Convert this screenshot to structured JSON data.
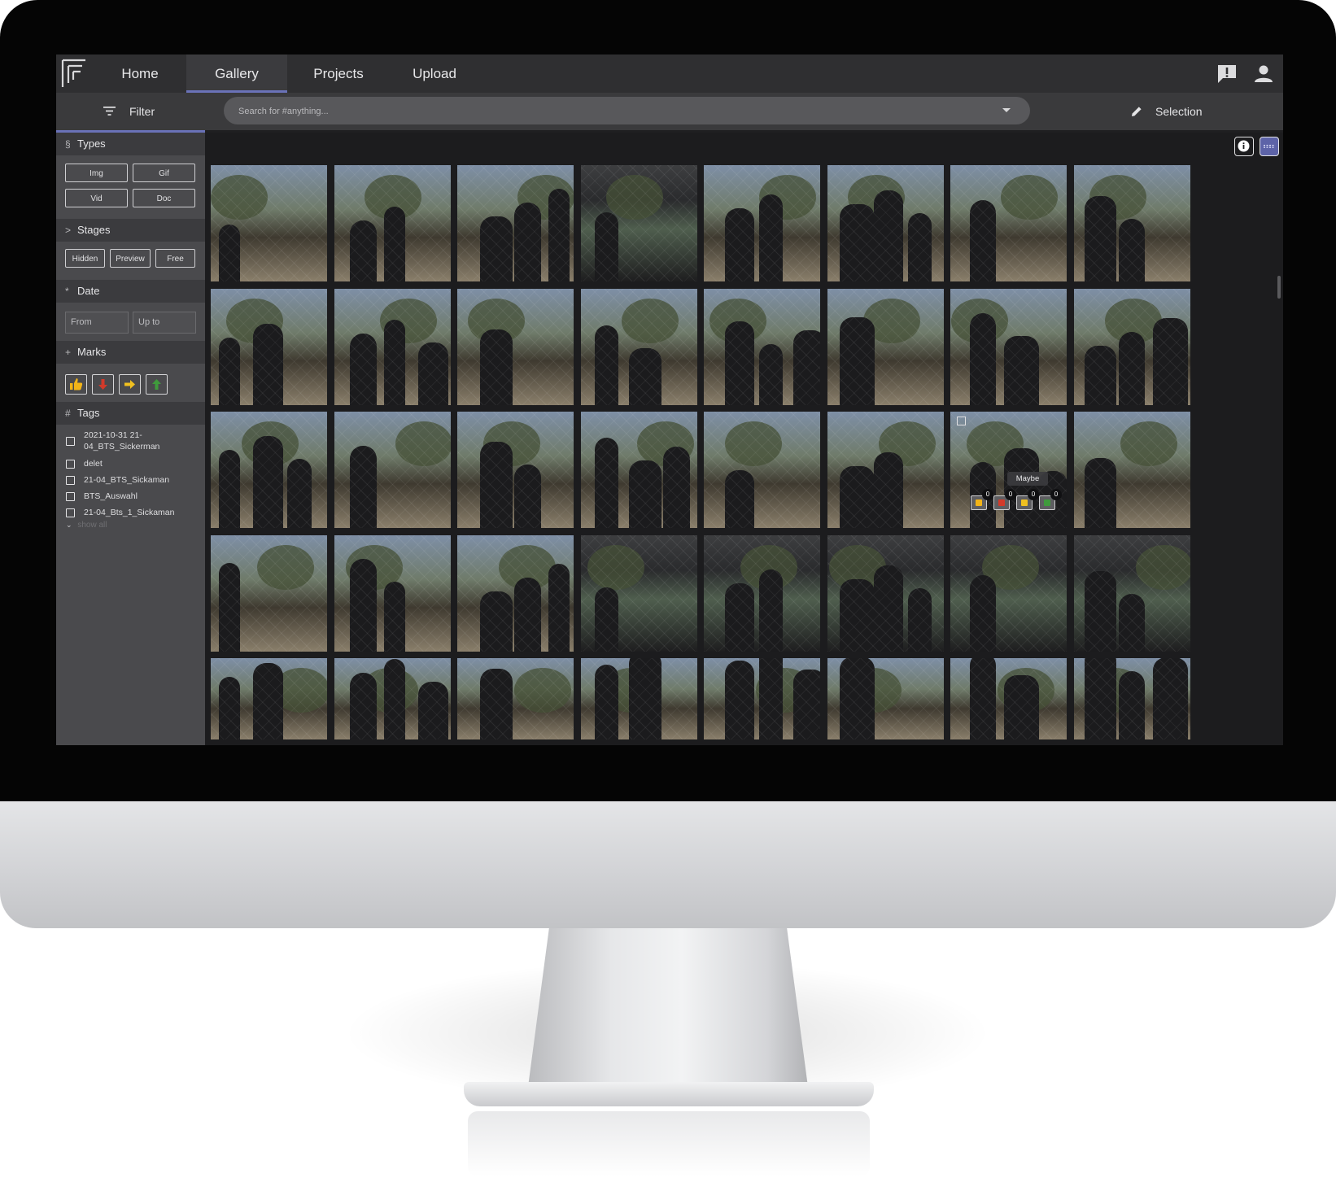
{
  "nav": {
    "items": [
      "Home",
      "Gallery",
      "Projects",
      "Upload"
    ],
    "active": "Gallery"
  },
  "toolbar": {
    "filter_label": "Filter",
    "search_placeholder": "Search for #anything...",
    "selection_label": "Selection"
  },
  "sidebar": {
    "types": {
      "symbol": "§",
      "title": "Types",
      "chips": [
        "Img",
        "Gif",
        "Vid",
        "Doc"
      ]
    },
    "stages": {
      "symbol": ">",
      "title": "Stages",
      "chips": [
        "Hidden",
        "Preview",
        "Free"
      ]
    },
    "date": {
      "symbol": "*",
      "title": "Date",
      "from_placeholder": "From",
      "upto_placeholder": "Up to"
    },
    "marks": {
      "symbol": "+",
      "title": "Marks",
      "icons": [
        "thumbs-up-icon",
        "arrow-down-icon",
        "arrow-right-icon",
        "arrow-up-icon"
      ]
    },
    "tags": {
      "symbol": "#",
      "title": "Tags",
      "items": [
        "2021-10-31 21-04_BTS_Sickerman",
        "delet",
        "21-04_BTS_Sickaman",
        "BTS_Auswahl",
        "21-04_Bts_1_Sickaman"
      ],
      "show_all": "show all"
    }
  },
  "gallery": {
    "rows": 5,
    "cols": 8,
    "hovered_tile": {
      "tooltip": "Maybe",
      "counts": [
        "0",
        "0",
        "0",
        "0"
      ]
    }
  },
  "colors": {
    "accent": "#6a72b8",
    "thumbs_up": "#f2b418",
    "down": "#d23a2a",
    "right": "#f0c020",
    "up": "#3f9a3c"
  }
}
